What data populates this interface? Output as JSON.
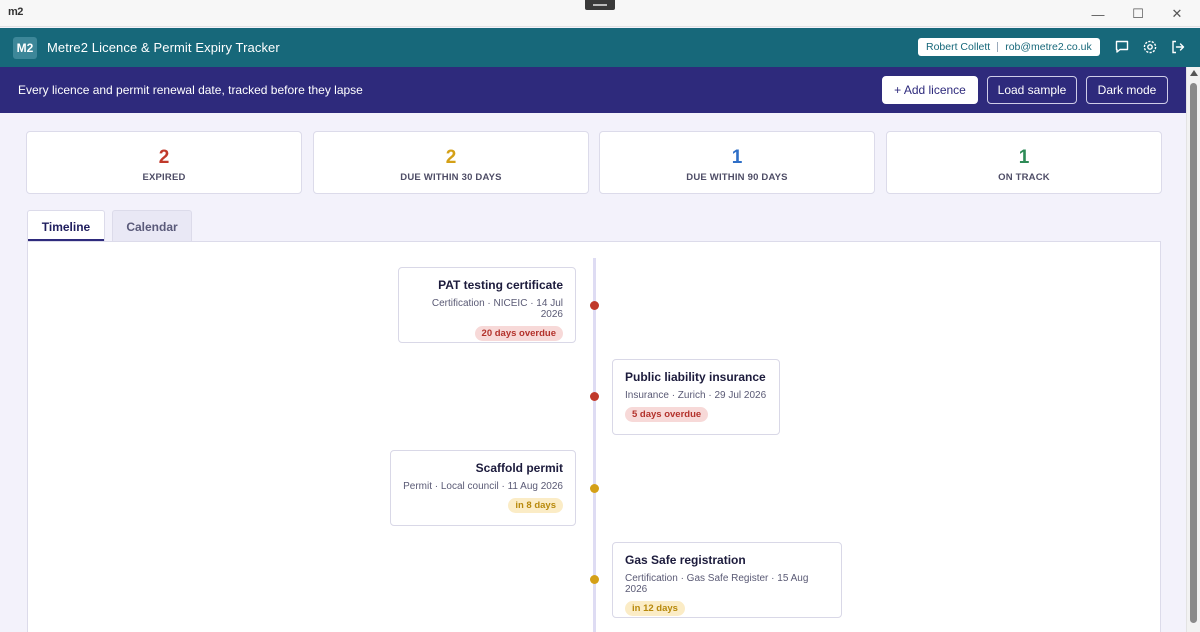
{
  "window": {
    "logo": "m2",
    "minimize_glyph": "—",
    "maximize_glyph": "☐",
    "close_glyph": "✕"
  },
  "header": {
    "badge": "M2",
    "title": "Metre2 Licence & Permit Expiry Tracker",
    "user_name": "Robert Collett",
    "user_email": "rob@metre2.co.uk",
    "icons": [
      "chat-icon",
      "settings-icon",
      "logout-icon"
    ]
  },
  "banner": {
    "tagline": "Every licence and permit renewal date, tracked before they lapse",
    "add_label": "+ Add licence",
    "sample_label": "Load sample",
    "dark_label": "Dark mode"
  },
  "stats": [
    {
      "value": "2",
      "label": "EXPIRED",
      "color": "#c0392b"
    },
    {
      "value": "2",
      "label": "DUE WITHIN 30 DAYS",
      "color": "#d4a017"
    },
    {
      "value": "1",
      "label": "DUE WITHIN 90 DAYS",
      "color": "#2f6fc7"
    },
    {
      "value": "1",
      "label": "ON TRACK",
      "color": "#2e8b57"
    }
  ],
  "tabs": [
    {
      "label": "Timeline",
      "active": true
    },
    {
      "label": "Calendar",
      "active": false
    }
  ],
  "timeline": [
    {
      "title": "PAT testing certificate",
      "meta": "Certification · NICEIC · 14 Jul 2026",
      "status": "20 days overdue",
      "tone": "red",
      "side": "left"
    },
    {
      "title": "Public liability insurance",
      "meta": "Insurance · Zurich · 29 Jul 2026",
      "status": "5 days overdue",
      "tone": "red",
      "side": "right"
    },
    {
      "title": "Scaffold permit",
      "meta": "Permit · Local council · 11 Aug 2026",
      "status": "in 8 days",
      "tone": "amber",
      "side": "left"
    },
    {
      "title": "Gas Safe registration",
      "meta": "Certification · Gas Safe Register · 15 Aug 2026",
      "status": "in 12 days",
      "tone": "amber",
      "side": "right"
    }
  ],
  "colors": {
    "header_bg": "#17687a",
    "banner_bg": "#2e2a7c",
    "overdue_dot": "#c0392b",
    "soon_dot": "#d4a017"
  }
}
